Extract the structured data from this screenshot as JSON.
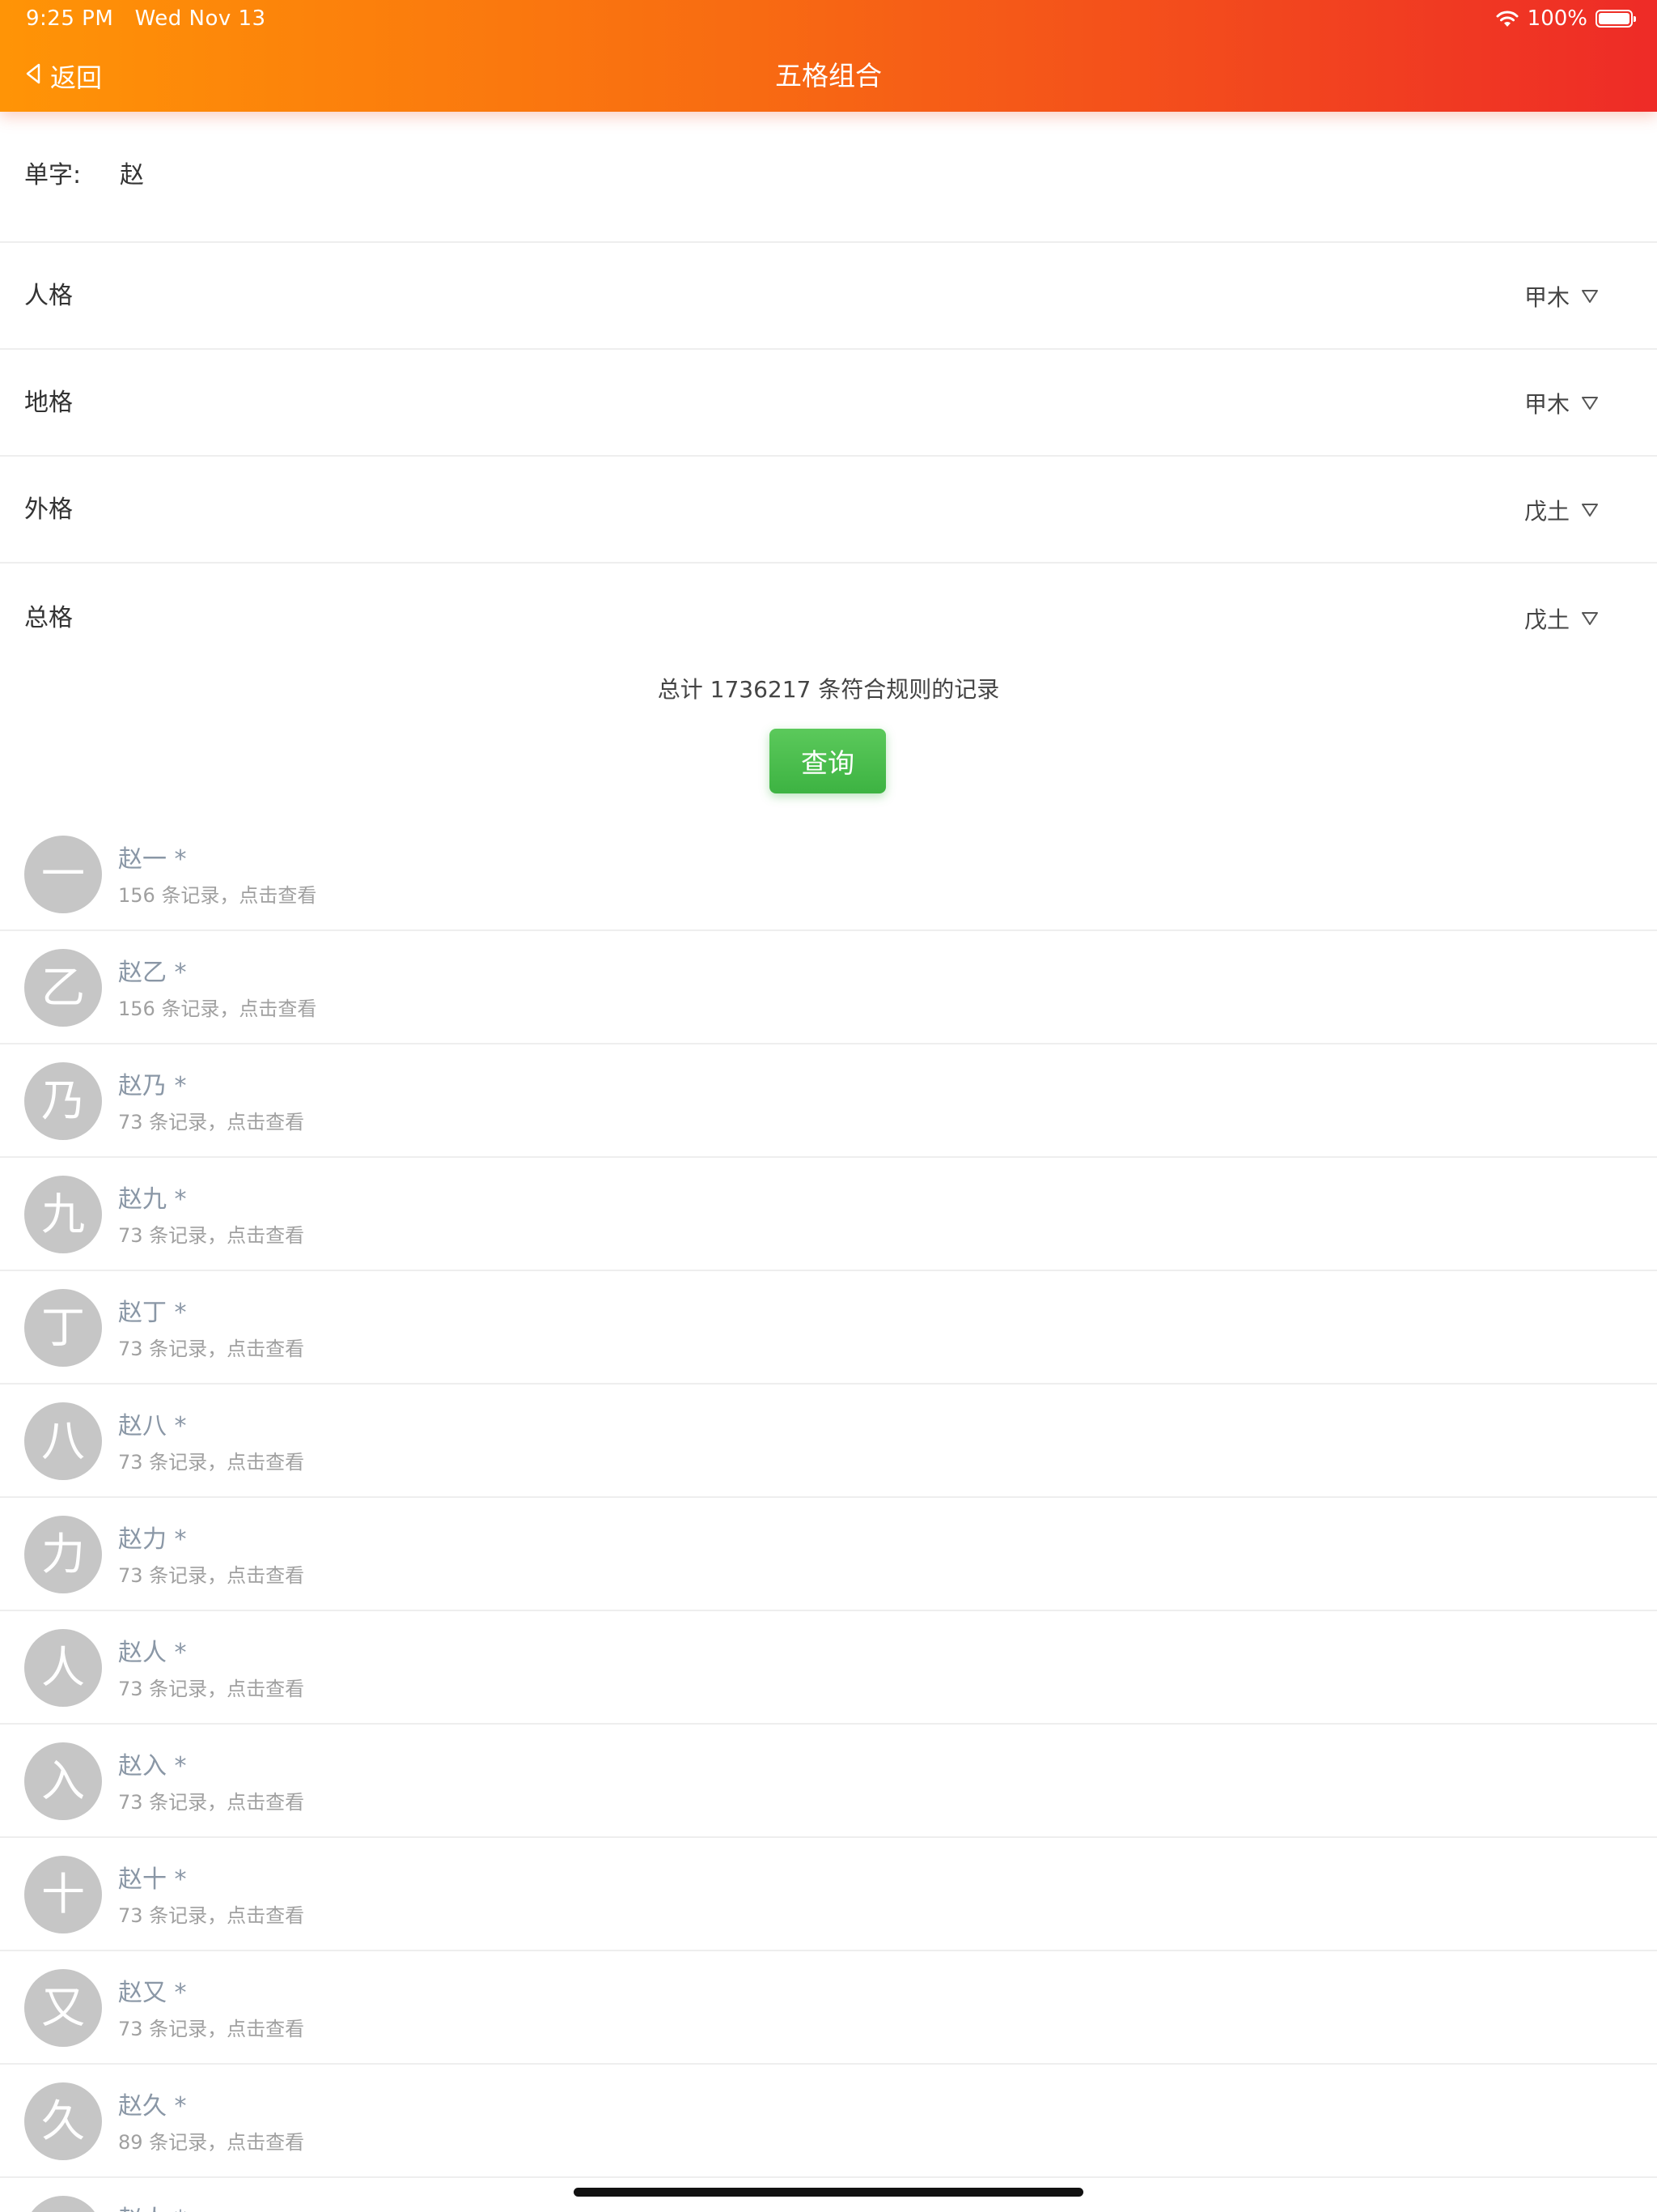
{
  "status_bar": {
    "time": "9:25 PM",
    "date": "Wed Nov 13",
    "battery": "100%",
    "battery_level": 1.0
  },
  "nav": {
    "back_label": "返回",
    "title": "五格组合"
  },
  "form": {
    "single_char_label": "单字:",
    "single_char_value": "赵",
    "rows": [
      {
        "label": "人格",
        "value": "甲木"
      },
      {
        "label": "地格",
        "value": "甲木"
      },
      {
        "label": "外格",
        "value": "戊土"
      },
      {
        "label": "总格",
        "value": "戊土"
      }
    ]
  },
  "summary": "总计 1736217 条符合规则的记录",
  "query_button": "查询",
  "list": [
    {
      "avatar": "一",
      "name": "赵一 *",
      "sub": "156 条记录，点击查看"
    },
    {
      "avatar": "乙",
      "name": "赵乙 *",
      "sub": "156 条记录，点击查看"
    },
    {
      "avatar": "乃",
      "name": "赵乃 *",
      "sub": "73 条记录，点击查看"
    },
    {
      "avatar": "九",
      "name": "赵九 *",
      "sub": "73 条记录，点击查看"
    },
    {
      "avatar": "丁",
      "name": "赵丁 *",
      "sub": "73 条记录，点击查看"
    },
    {
      "avatar": "八",
      "name": "赵八 *",
      "sub": "73 条记录，点击查看"
    },
    {
      "avatar": "力",
      "name": "赵力 *",
      "sub": "73 条记录，点击查看"
    },
    {
      "avatar": "人",
      "name": "赵人 *",
      "sub": "73 条记录，点击查看"
    },
    {
      "avatar": "入",
      "name": "赵入 *",
      "sub": "73 条记录，点击查看"
    },
    {
      "avatar": "十",
      "name": "赵十 *",
      "sub": "73 条记录，点击查看"
    },
    {
      "avatar": "又",
      "name": "赵又 *",
      "sub": "73 条记录，点击查看"
    },
    {
      "avatar": "久",
      "name": "赵久 *",
      "sub": "89 条记录，点击查看"
    },
    {
      "avatar": "",
      "name": "赵人 *",
      "sub": ""
    }
  ],
  "colors": {
    "header_gradient_start": "#ff9406",
    "header_gradient_end": "#ee2b27",
    "query_button": "#3db342",
    "avatar_bg": "#c6c6c6",
    "item_name": "#8a97a6"
  },
  "icons": {
    "back": "chevron-left-icon",
    "wifi": "wifi-icon",
    "battery": "battery-icon",
    "picker": "triangle-down-icon"
  }
}
